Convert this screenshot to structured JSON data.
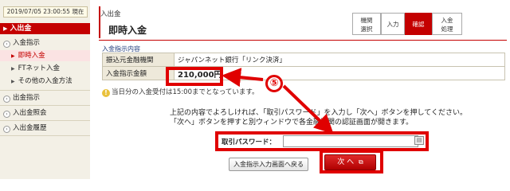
{
  "sidebar": {
    "datetime": "2019/07/05 23:00:55 現在",
    "header": "入出金",
    "items": [
      {
        "label": "入金指示",
        "level": 0,
        "active": false
      },
      {
        "label": "即時入金",
        "level": 1,
        "active": true
      },
      {
        "label": "FTネット入金",
        "level": 1,
        "active": false
      },
      {
        "label": "その他の入金方法",
        "level": 1,
        "active": false
      },
      {
        "label": "出金指示",
        "level": 0,
        "active": false
      },
      {
        "label": "入出金照会",
        "level": 0,
        "active": false
      },
      {
        "label": "入出金履歴",
        "level": 0,
        "active": false
      }
    ]
  },
  "header": {
    "breadcrumb": "入出金",
    "title": "即時入金"
  },
  "steps": [
    {
      "line1": "機関",
      "line2": "選択",
      "active": false
    },
    {
      "line1": "入力",
      "line2": "",
      "active": false
    },
    {
      "line1": "確認",
      "line2": "",
      "active": true
    },
    {
      "line1": "入金",
      "line2": "処理",
      "active": false
    }
  ],
  "details": {
    "section_label": "入金指示内容",
    "rows": [
      {
        "label": "振込元金融機関",
        "value": "ジャパンネット銀行「リンク決済」"
      },
      {
        "label": "入金指示金額",
        "value": "210,000円"
      }
    ]
  },
  "note": "当日分の入金受付は15:00までとなっています。",
  "instructions": {
    "line1": "上記の内容でよろしければ、「取引パスワード」を入力し「次へ」ボタンを押してください。",
    "line2": "「次へ」ボタンを押すと別ウィンドウで各金融機関の認証画面が開きます。"
  },
  "password": {
    "label": "取引パスワード：",
    "value": "",
    "placeholder": ""
  },
  "buttons": {
    "back": "入金指示入力画面へ戻る",
    "next": "次 へ"
  },
  "annotation": {
    "marker": "⑤",
    "color": "#e00000"
  },
  "colors": {
    "accent": "#c40000",
    "sidebar_bg": "#f3f0e6"
  }
}
